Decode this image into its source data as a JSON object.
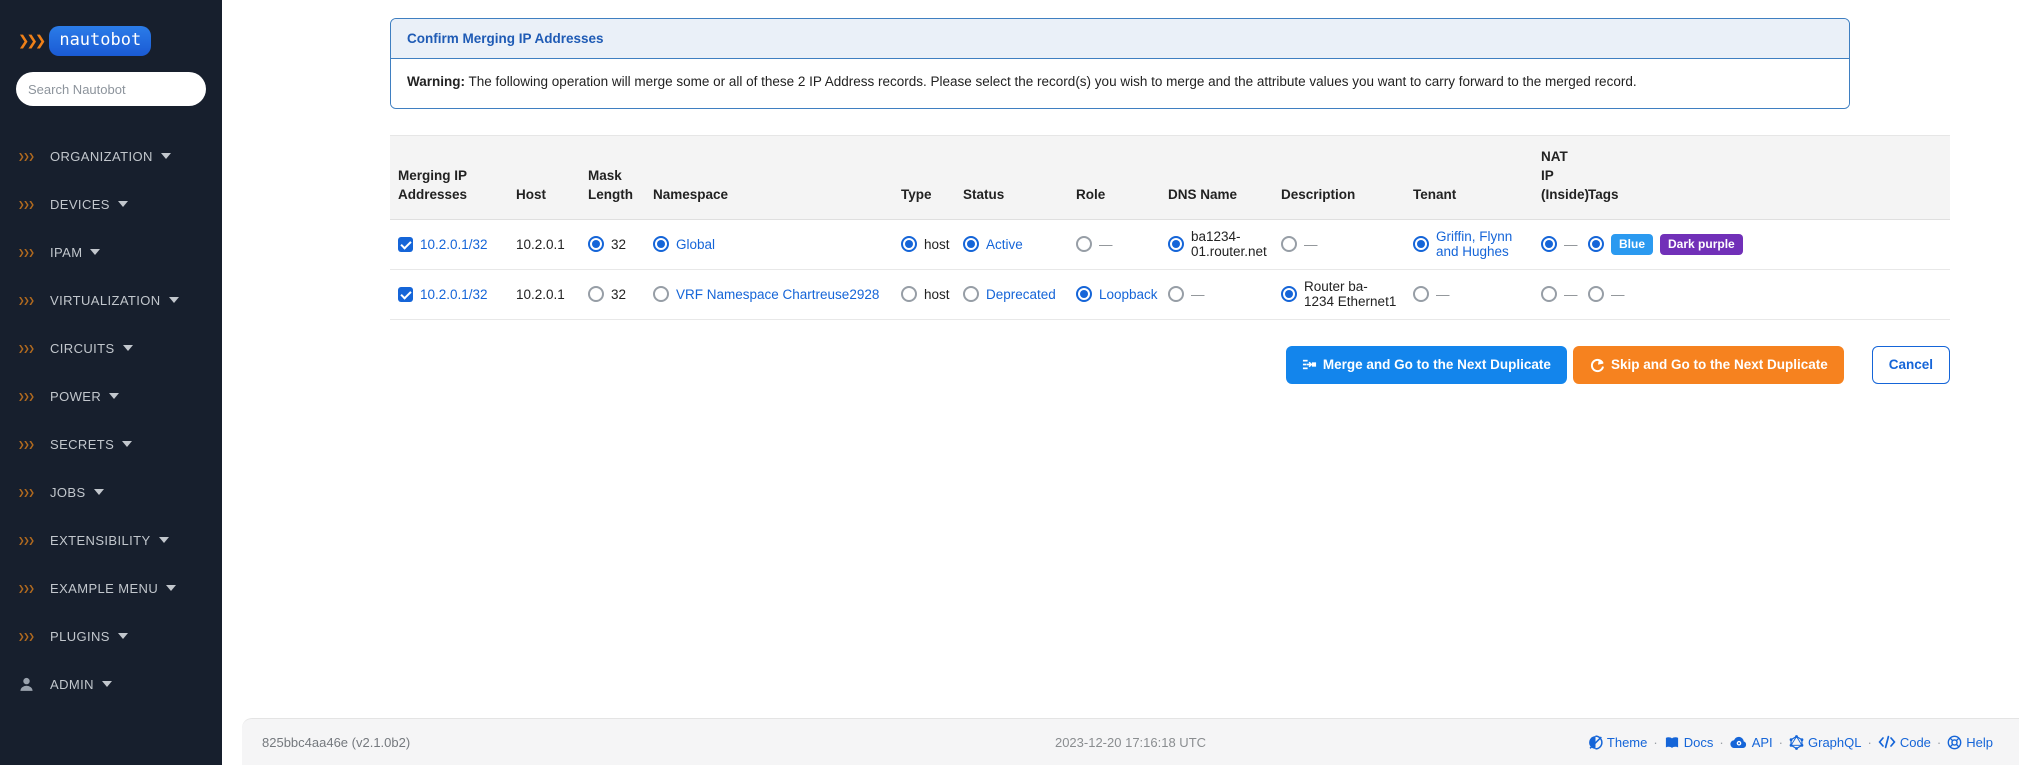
{
  "sidebar": {
    "logo_text": "nautobot",
    "search": {
      "placeholder": "Search Nautobot"
    },
    "items": [
      {
        "label": "ORGANIZATION",
        "icon": "chevrons"
      },
      {
        "label": "DEVICES",
        "icon": "chevrons"
      },
      {
        "label": "IPAM",
        "icon": "chevrons"
      },
      {
        "label": "VIRTUALIZATION",
        "icon": "chevrons"
      },
      {
        "label": "CIRCUITS",
        "icon": "chevrons"
      },
      {
        "label": "POWER",
        "icon": "chevrons"
      },
      {
        "label": "SECRETS",
        "icon": "chevrons"
      },
      {
        "label": "JOBS",
        "icon": "chevrons"
      },
      {
        "label": "EXTENSIBILITY",
        "icon": "chevrons"
      },
      {
        "label": "EXAMPLE MENU",
        "icon": "chevrons"
      },
      {
        "label": "PLUGINS",
        "icon": "chevrons"
      },
      {
        "label": "ADMIN",
        "icon": "user"
      }
    ]
  },
  "panel": {
    "title": "Confirm Merging IP Addresses",
    "warning_label": "Warning:",
    "warning_text": " The following operation will merge some or all of these 2 IP Address records. Please select the record(s) you wish to merge and the attribute values you want to carry forward to the merged record."
  },
  "table": {
    "columns": [
      "Merging IP Addresses",
      "Host",
      "Mask Length",
      "Namespace",
      "Type",
      "Status",
      "Role",
      "DNS Name",
      "Description",
      "Tenant",
      "NAT IP (Inside)",
      "Tags"
    ],
    "rows": [
      {
        "cells": [
          {
            "control": "checkbox",
            "checked": true,
            "text": "10.2.0.1/32",
            "link": true
          },
          {
            "control": "none",
            "text": "10.2.0.1"
          },
          {
            "control": "radio",
            "selected": true,
            "text": "32"
          },
          {
            "control": "radio",
            "selected": true,
            "text": "Global",
            "link": true
          },
          {
            "control": "radio",
            "selected": true,
            "text": "host"
          },
          {
            "control": "radio",
            "selected": true,
            "text": "Active",
            "link": true
          },
          {
            "control": "radio",
            "selected": false,
            "text": "—",
            "muted": true
          },
          {
            "control": "radio",
            "selected": true,
            "text": "ba1234-01.router.net"
          },
          {
            "control": "radio",
            "selected": false,
            "text": "—",
            "muted": true
          },
          {
            "control": "radio",
            "selected": true,
            "text": "Griffin, Flynn and Hughes",
            "link": true
          },
          {
            "control": "radio",
            "selected": true,
            "text": "—",
            "muted": true
          },
          {
            "control": "radio",
            "selected": true,
            "badges": [
              {
                "label": "Blue",
                "color": "#2b9af0"
              },
              {
                "label": "Dark purple",
                "color": "#7130b8"
              }
            ]
          }
        ]
      },
      {
        "cells": [
          {
            "control": "checkbox",
            "checked": true,
            "text": "10.2.0.1/32",
            "link": true
          },
          {
            "control": "none",
            "text": "10.2.0.1"
          },
          {
            "control": "radio",
            "selected": false,
            "text": "32"
          },
          {
            "control": "radio",
            "selected": false,
            "text": "VRF Namespace Chartreuse2928",
            "link": true
          },
          {
            "control": "radio",
            "selected": false,
            "text": "host"
          },
          {
            "control": "radio",
            "selected": false,
            "text": "Deprecated",
            "link": true
          },
          {
            "control": "radio",
            "selected": true,
            "text": "Loopback",
            "link": true
          },
          {
            "control": "radio",
            "selected": false,
            "text": "—",
            "muted": true
          },
          {
            "control": "radio",
            "selected": true,
            "text": "Router ba-1234 Ethernet1"
          },
          {
            "control": "radio",
            "selected": false,
            "text": "—",
            "muted": true
          },
          {
            "control": "radio",
            "selected": false,
            "text": "—",
            "muted": true
          },
          {
            "control": "radio",
            "selected": false,
            "text": "—",
            "muted": true
          }
        ]
      }
    ]
  },
  "actions": {
    "merge_label": "Merge and Go to the Next Duplicate",
    "skip_label": "Skip and Go to the Next Duplicate",
    "cancel_label": "Cancel"
  },
  "footer": {
    "version": "825bbc4aa46e (v2.1.0b2)",
    "timestamp": "2023-12-20 17:16:18 UTC",
    "links": [
      {
        "label": "Theme",
        "icon": "theme"
      },
      {
        "label": "Docs",
        "icon": "docs"
      },
      {
        "label": "API",
        "icon": "api"
      },
      {
        "label": "GraphQL",
        "icon": "graphql"
      },
      {
        "label": "Code",
        "icon": "code"
      },
      {
        "label": "Help",
        "icon": "help"
      }
    ]
  },
  "colors": {
    "sidebar_bg": "#171f2d",
    "accent_orange": "#ef8018",
    "link_blue": "#1565d8",
    "button_blue": "#1385ec",
    "button_orange": "#f6821f",
    "panel_border": "#3f7fc1",
    "badge_blue": "#2b9af0",
    "badge_purple": "#7130b8"
  }
}
